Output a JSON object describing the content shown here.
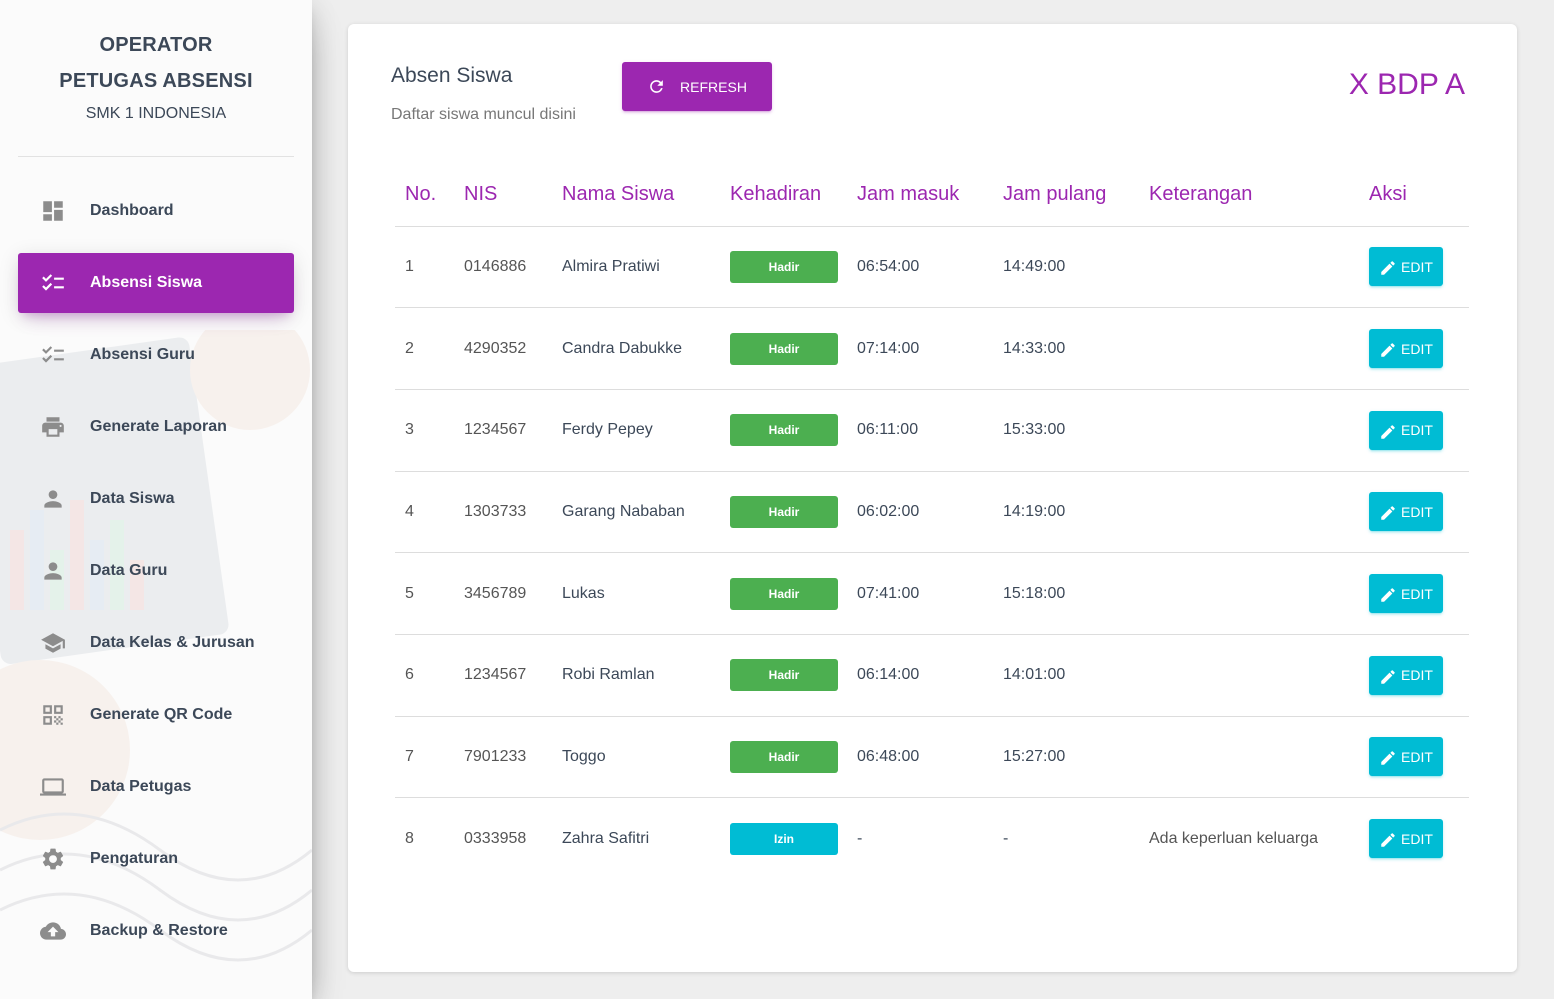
{
  "sidebar": {
    "title_line1": "OPERATOR",
    "title_line2": "PETUGAS ABSENSI",
    "school": "SMK 1 INDONESIA",
    "items": [
      {
        "label": "Dashboard",
        "icon": "dashboard-icon",
        "active": false
      },
      {
        "label": "Absensi Siswa",
        "icon": "checklist-icon",
        "active": true
      },
      {
        "label": "Absensi Guru",
        "icon": "checklist-icon",
        "active": false
      },
      {
        "label": "Generate Laporan",
        "icon": "printer-icon",
        "active": false
      },
      {
        "label": "Data Siswa",
        "icon": "person-icon",
        "active": false
      },
      {
        "label": "Data Guru",
        "icon": "person-icon",
        "active": false
      },
      {
        "label": "Data Kelas & Jurusan",
        "icon": "school-icon",
        "active": false
      },
      {
        "label": "Generate QR Code",
        "icon": "qr-code-icon",
        "active": false
      },
      {
        "label": "Data Petugas",
        "icon": "laptop-icon",
        "active": false
      },
      {
        "label": "Pengaturan",
        "icon": "gear-icon",
        "active": false
      },
      {
        "label": "Backup & Restore",
        "icon": "cloud-upload-icon",
        "active": false
      }
    ]
  },
  "main": {
    "title": "Absen Siswa",
    "subtitle": "Daftar siswa muncul disini",
    "refresh_label": "REFRESH",
    "class_name": "X BDP A",
    "table": {
      "headers": [
        "No.",
        "NIS",
        "Nama Siswa",
        "Kehadiran",
        "Jam masuk",
        "Jam pulang",
        "Keterangan",
        "Aksi"
      ],
      "edit_label": "EDIT",
      "rows": [
        {
          "no": "1",
          "nis": "0146886",
          "name": "Almira Pratiwi",
          "status": "Hadir",
          "in": "06:54:00",
          "out": "14:49:00",
          "note": ""
        },
        {
          "no": "2",
          "nis": "4290352",
          "name": "Candra Dabukke",
          "status": "Hadir",
          "in": "07:14:00",
          "out": "14:33:00",
          "note": ""
        },
        {
          "no": "3",
          "nis": "1234567",
          "name": "Ferdy Pepey",
          "status": "Hadir",
          "in": "06:11:00",
          "out": "15:33:00",
          "note": ""
        },
        {
          "no": "4",
          "nis": "1303733",
          "name": "Garang Nababan",
          "status": "Hadir",
          "in": "06:02:00",
          "out": "14:19:00",
          "note": ""
        },
        {
          "no": "5",
          "nis": "3456789",
          "name": "Lukas",
          "status": "Hadir",
          "in": "07:41:00",
          "out": "15:18:00",
          "note": ""
        },
        {
          "no": "6",
          "nis": "1234567",
          "name": "Robi Ramlan",
          "status": "Hadir",
          "in": "06:14:00",
          "out": "14:01:00",
          "note": ""
        },
        {
          "no": "7",
          "nis": "7901233",
          "name": "Toggo",
          "status": "Hadir",
          "in": "06:48:00",
          "out": "15:27:00",
          "note": ""
        },
        {
          "no": "8",
          "nis": "0333958",
          "name": "Zahra Safitri",
          "status": "Izin",
          "in": "-",
          "out": "-",
          "note": "Ada keperluan keluarga"
        }
      ]
    }
  },
  "colors": {
    "primary": "#9c27b0",
    "hadir": "#4caf50",
    "izin": "#00bcd4",
    "edit": "#00bcd4"
  }
}
